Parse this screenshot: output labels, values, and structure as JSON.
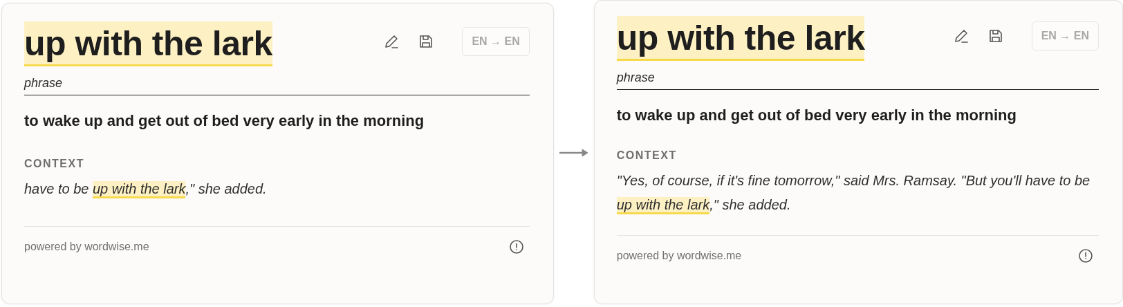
{
  "cards": [
    {
      "headword": "up with the lark",
      "part_of_speech": "phrase",
      "definition": "to wake up and get out of bed very early in the morning",
      "context_label": "CONTEXT",
      "context": {
        "before": "have to be ",
        "highlight": "up with the lark",
        "after": ",\" she added."
      },
      "language_button": "EN → EN",
      "footer": "powered by wordwise.me"
    },
    {
      "headword": "up with the lark",
      "part_of_speech": "phrase",
      "definition": "to wake up and get out of bed very early in the morning",
      "context_label": "CONTEXT",
      "context": {
        "before": "\"Yes, of course, if it's fine tomorrow,\" said Mrs. Ramsay. \"But you'll have to be ",
        "highlight": "up with the lark",
        "after": ",\" she added."
      },
      "language_button": "EN → EN",
      "footer": "powered by wordwise.me"
    }
  ]
}
